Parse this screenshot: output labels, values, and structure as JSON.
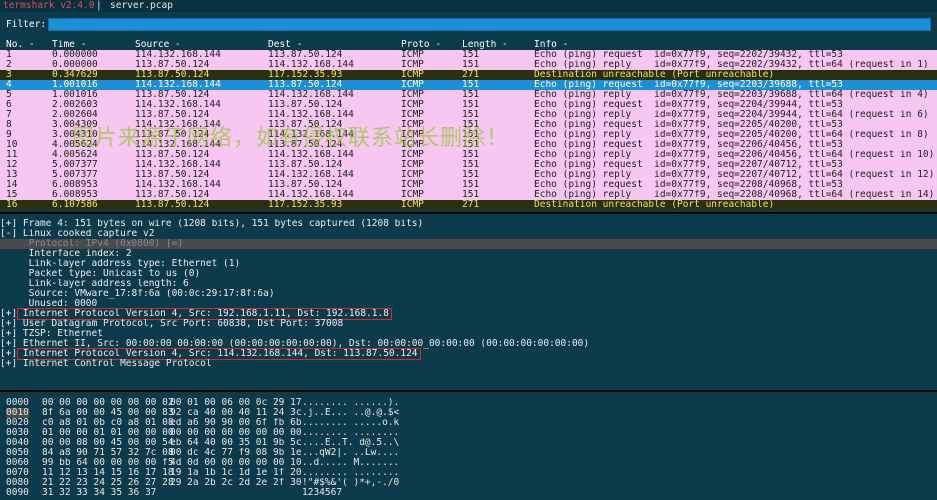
{
  "title": {
    "app": "termshark v2.4.0",
    "sep": "|",
    "file": "server.pcap"
  },
  "filter": {
    "label": "Filter:",
    "value": ""
  },
  "columns": [
    "No. -",
    "Time -",
    "Source -",
    "Dest -",
    "Proto -",
    "Length -",
    "Info -"
  ],
  "packets": [
    {
      "no": "1",
      "time": "0.000000",
      "src": "114.132.168.144",
      "dst": "113.87.50.124",
      "proto": "ICMP",
      "len": "151",
      "info": "Echo (ping) request  id=0x77f9, seq=2202/39432, ttl=53",
      "style": "pink"
    },
    {
      "no": "2",
      "time": "0.000000",
      "src": "113.87.50.124",
      "dst": "114.132.168.144",
      "proto": "ICMP",
      "len": "151",
      "info": "Echo (ping) reply    id=0x77f9, seq=2202/39432, ttl=64 (request in 1)",
      "style": "pink"
    },
    {
      "no": "3",
      "time": "0.347629",
      "src": "113.87.50.124",
      "dst": "117.152.35.93",
      "proto": "ICMP",
      "len": "271",
      "info": "Destination unreachable (Port unreachable)",
      "style": "dark"
    },
    {
      "no": "4",
      "time": "1.001016",
      "src": "114.132.168.144",
      "dst": "113.87.50.124",
      "proto": "ICMP",
      "len": "151",
      "info": "Echo (ping) request  id=0x77f9, seq=2203/39688, ttl=53",
      "style": "sel"
    },
    {
      "no": "5",
      "time": "1.001016",
      "src": "113.87.50.124",
      "dst": "114.132.168.144",
      "proto": "ICMP",
      "len": "151",
      "info": "Echo (ping) reply    id=0x77f9, seq=2203/39688, ttl=64 (request in 4)",
      "style": "pink"
    },
    {
      "no": "6",
      "time": "2.002603",
      "src": "114.132.168.144",
      "dst": "113.87.50.124",
      "proto": "ICMP",
      "len": "151",
      "info": "Echo (ping) request  id=0x77f9, seq=2204/39944, ttl=53",
      "style": "pink"
    },
    {
      "no": "7",
      "time": "2.002604",
      "src": "113.87.50.124",
      "dst": "114.132.168.144",
      "proto": "ICMP",
      "len": "151",
      "info": "Echo (ping) reply    id=0x77f9, seq=2204/39944, ttl=64 (request in 6)",
      "style": "pink"
    },
    {
      "no": "8",
      "time": "3.004309",
      "src": "114.132.168.144",
      "dst": "113.87.50.124",
      "proto": "ICMP",
      "len": "151",
      "info": "Echo (ping) request  id=0x77f9, seq=2205/40200, ttl=53",
      "style": "pink"
    },
    {
      "no": "9",
      "time": "3.004310",
      "src": "113.87.50.124",
      "dst": "114.132.168.144",
      "proto": "ICMP",
      "len": "151",
      "info": "Echo (ping) reply    id=0x77f9, seq=2205/40200, ttl=64 (request in 8)",
      "style": "pink"
    },
    {
      "no": "10",
      "time": "4.005624",
      "src": "114.132.168.144",
      "dst": "113.87.50.124",
      "proto": "ICMP",
      "len": "151",
      "info": "Echo (ping) request  id=0x77f9, seq=2206/40456, ttl=53",
      "style": "pink"
    },
    {
      "no": "11",
      "time": "4.005624",
      "src": "113.87.50.124",
      "dst": "114.132.168.144",
      "proto": "ICMP",
      "len": "151",
      "info": "Echo (ping) reply    id=0x77f9, seq=2206/40456, ttl=64 (request in 10)",
      "style": "pink"
    },
    {
      "no": "12",
      "time": "5.007377",
      "src": "114.132.168.144",
      "dst": "113.87.50.124",
      "proto": "ICMP",
      "len": "151",
      "info": "Echo (ping) request  id=0x77f9, seq=2207/40712, ttl=53",
      "style": "pink"
    },
    {
      "no": "13",
      "time": "5.007377",
      "src": "113.87.50.124",
      "dst": "114.132.168.144",
      "proto": "ICMP",
      "len": "151",
      "info": "Echo (ping) reply    id=0x77f9, seq=2207/40712, ttl=64 (request in 12)",
      "style": "pink"
    },
    {
      "no": "14",
      "time": "6.008953",
      "src": "114.132.168.144",
      "dst": "113.87.50.124",
      "proto": "ICMP",
      "len": "151",
      "info": "Echo (ping) request  id=0x77f9, seq=2208/40968, ttl=53",
      "style": "pink"
    },
    {
      "no": "15",
      "time": "6.008953",
      "src": "113.87.50.124",
      "dst": "114.132.168.144",
      "proto": "ICMP",
      "len": "151",
      "info": "Echo (ping) reply    id=0x77f9, seq=2208/40968, ttl=64 (request in 14)",
      "style": "pink"
    },
    {
      "no": "16",
      "time": "6.107586",
      "src": "113.87.50.124",
      "dst": "117.152.35.93",
      "proto": "ICMP",
      "len": "271",
      "info": "Destination unreachable (Port unreachable)",
      "style": "dark"
    }
  ],
  "details": [
    {
      "text": "[+] Frame 4: 151 bytes on wire (1208 bits), 151 bytes captured (1208 bits)",
      "style": ""
    },
    {
      "text": "[-] Linux cooked capture v2",
      "style": ""
    },
    {
      "text": "     Protocol: IPv4 (0x0800) [=]",
      "style": "hl"
    },
    {
      "text": "     Interface index: 2",
      "style": ""
    },
    {
      "text": "     Link-layer address type: Ethernet (1)",
      "style": ""
    },
    {
      "text": "     Packet type: Unicast to us (0)",
      "style": ""
    },
    {
      "text": "     Link-layer address length: 6",
      "style": ""
    },
    {
      "text": "     Source: VMware_17:8f:6a (00:0c:29:17:8f:6a)",
      "style": ""
    },
    {
      "text": "     Unused: 0000",
      "style": ""
    },
    {
      "text": "[+] Internet Protocol Version 4, Src: 192.168.1.11, Dst: 192.168.1.8",
      "style": "box"
    },
    {
      "text": "[+] User Datagram Protocol, Src Port: 60838, Dst Port: 37008",
      "style": ""
    },
    {
      "text": "[+] TZSP: Ethernet",
      "style": ""
    },
    {
      "text": "[+] Ethernet II, Src: 00:00:00_00:00:00 (00:00:00:00:00:00), Dst: 00:00:00_00:00:00 (00:00:00:00:00:00)",
      "style": ""
    },
    {
      "text": "[+] Internet Protocol Version 4, Src: 114.132.168.144, Dst: 113.87.50.124",
      "style": "box"
    },
    {
      "text": "[+] Internet Control Message Protocol",
      "style": ""
    }
  ],
  "hex_rows": [
    {
      "off": "0000",
      "b1": "00 00 00 00 00 00 00 02",
      "b2": "00 01 00 06 00 0c 29 17",
      "asc": "........ ......)."
    },
    {
      "off": "0010",
      "b1": "8f 6a 00 00 45 00 00 83",
      "b2": "92 ca 40 00 40 11 24 3c",
      "asc": ".j..E... ..@.@.$<"
    },
    {
      "off": "0020",
      "b1": "c0 a8 01 0b c0 a8 01 08",
      "b2": "ed a6 90 90 00 6f fb 6b",
      "asc": "........ .....o.k"
    },
    {
      "off": "0030",
      "b1": "01 00 00 01 01 00 00 00",
      "b2": "00 00 00 00 00 00 00 00",
      "asc": "........ ........"
    },
    {
      "off": "0040",
      "b1": "00 00 08 00 45 00 00 54",
      "b2": "eb 64 40 00 35 01 9b 5c",
      "asc": "....E..T. d@.5..\\"
    },
    {
      "off": "0050",
      "b1": "84 a8 90 71 57 32 7c 08",
      "b2": "00 dc 4c 77 f9 08 9b 1e",
      "asc": "...qW2|. ..Lw...."
    },
    {
      "off": "0060",
      "b1": "99 bb 64 00 00 00 00 f5",
      "b2": "4d 0d 00 00 00 00 00 10",
      "asc": "..d..... M......."
    },
    {
      "off": "0070",
      "b1": "11 12 13 14 15 16 17 18",
      "b2": "19 1a 1b 1c 1d 1e 1f 20",
      "asc": "........ ........"
    },
    {
      "off": "0080",
      "b1": "21 22 23 24 25 26 27 28",
      "b2": "29 2a 2b 2c 2d 2e 2f 30",
      "asc": "!\"#$%&'( )*+,-./0"
    },
    {
      "off": "0090",
      "b1": "31 32 33 34 35 36 37",
      "b2": "",
      "asc": "1234567"
    }
  ],
  "watermark": "图片来源于网络，如有侵权联系站长删除！"
}
